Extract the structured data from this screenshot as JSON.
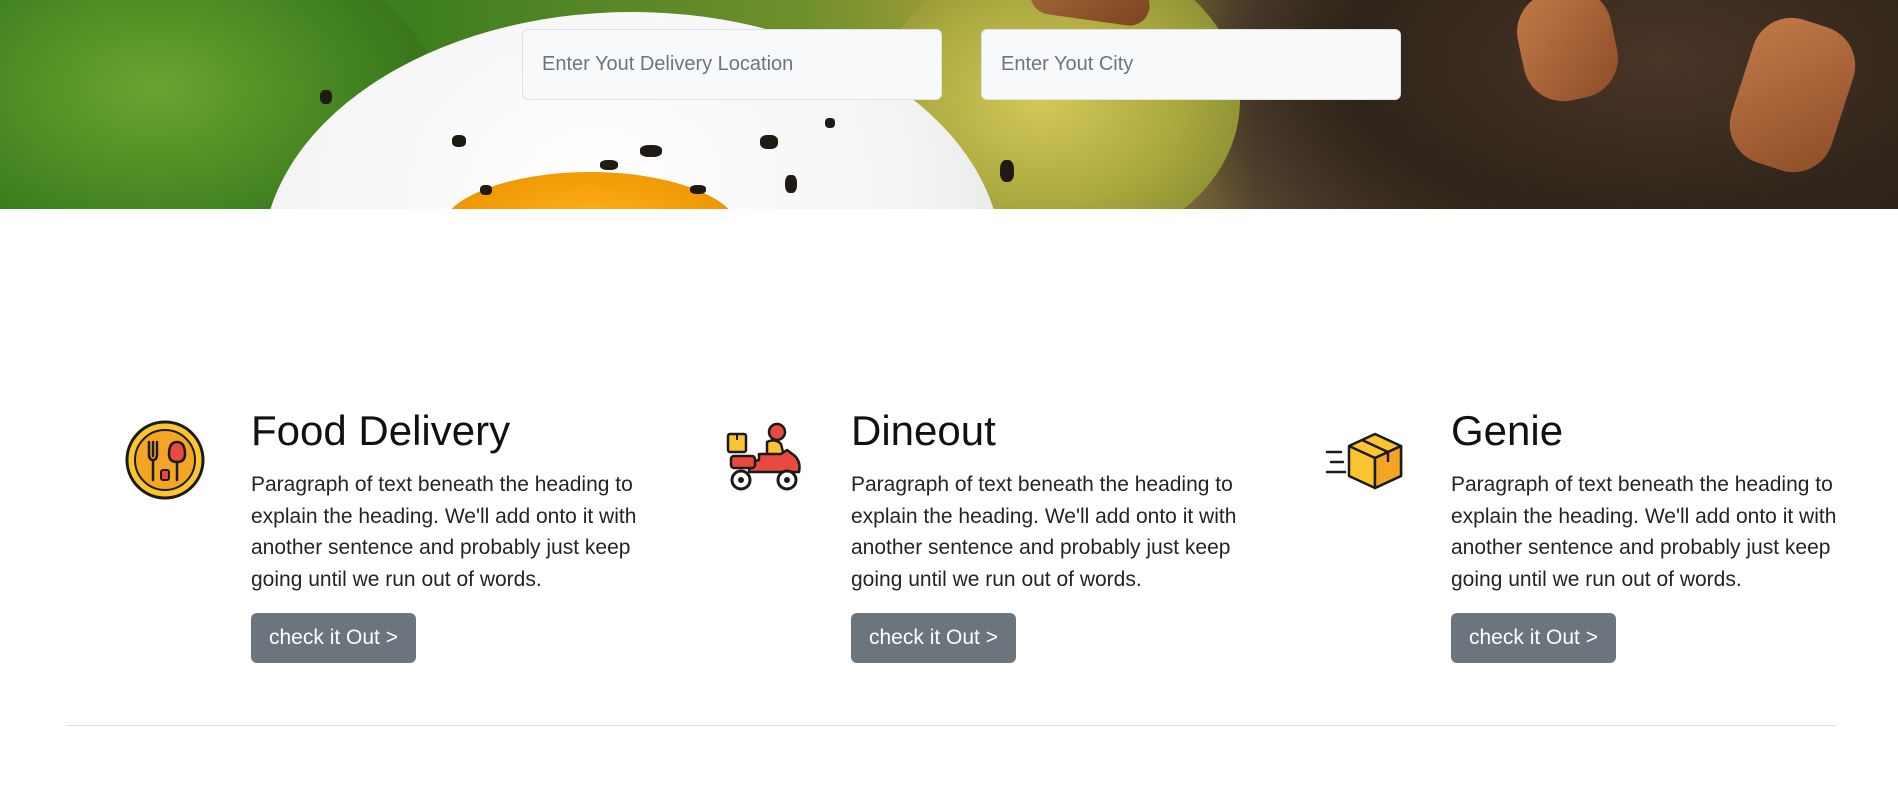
{
  "search": {
    "location_placeholder": "Enter Yout Delivery Location",
    "city_placeholder": "Enter Yout City"
  },
  "features": [
    {
      "heading": "Food Delivery",
      "paragraph": "Paragraph of text beneath the heading to explain the heading. We'll add onto it with another sentence and probably just keep going until we run out of words.",
      "button_label": "check it Out >",
      "icon": "restaurant-cutlery-icon"
    },
    {
      "heading": "Dineout",
      "paragraph": "Paragraph of text beneath the heading to explain the heading. We'll add onto it with another sentence and probably just keep going until we run out of words.",
      "button_label": "check it Out >",
      "icon": "delivery-scooter-icon"
    },
    {
      "heading": "Genie",
      "paragraph": "Paragraph of text beneath the heading to explain the heading. We'll add onto it with another sentence and probably just keep going until we run out of words.",
      "button_label": "check it Out >",
      "icon": "fast-package-icon"
    }
  ],
  "colors": {
    "button_bg": "#6c757d",
    "icon_yellow": "#fbc531",
    "icon_red": "#e84a3f"
  }
}
